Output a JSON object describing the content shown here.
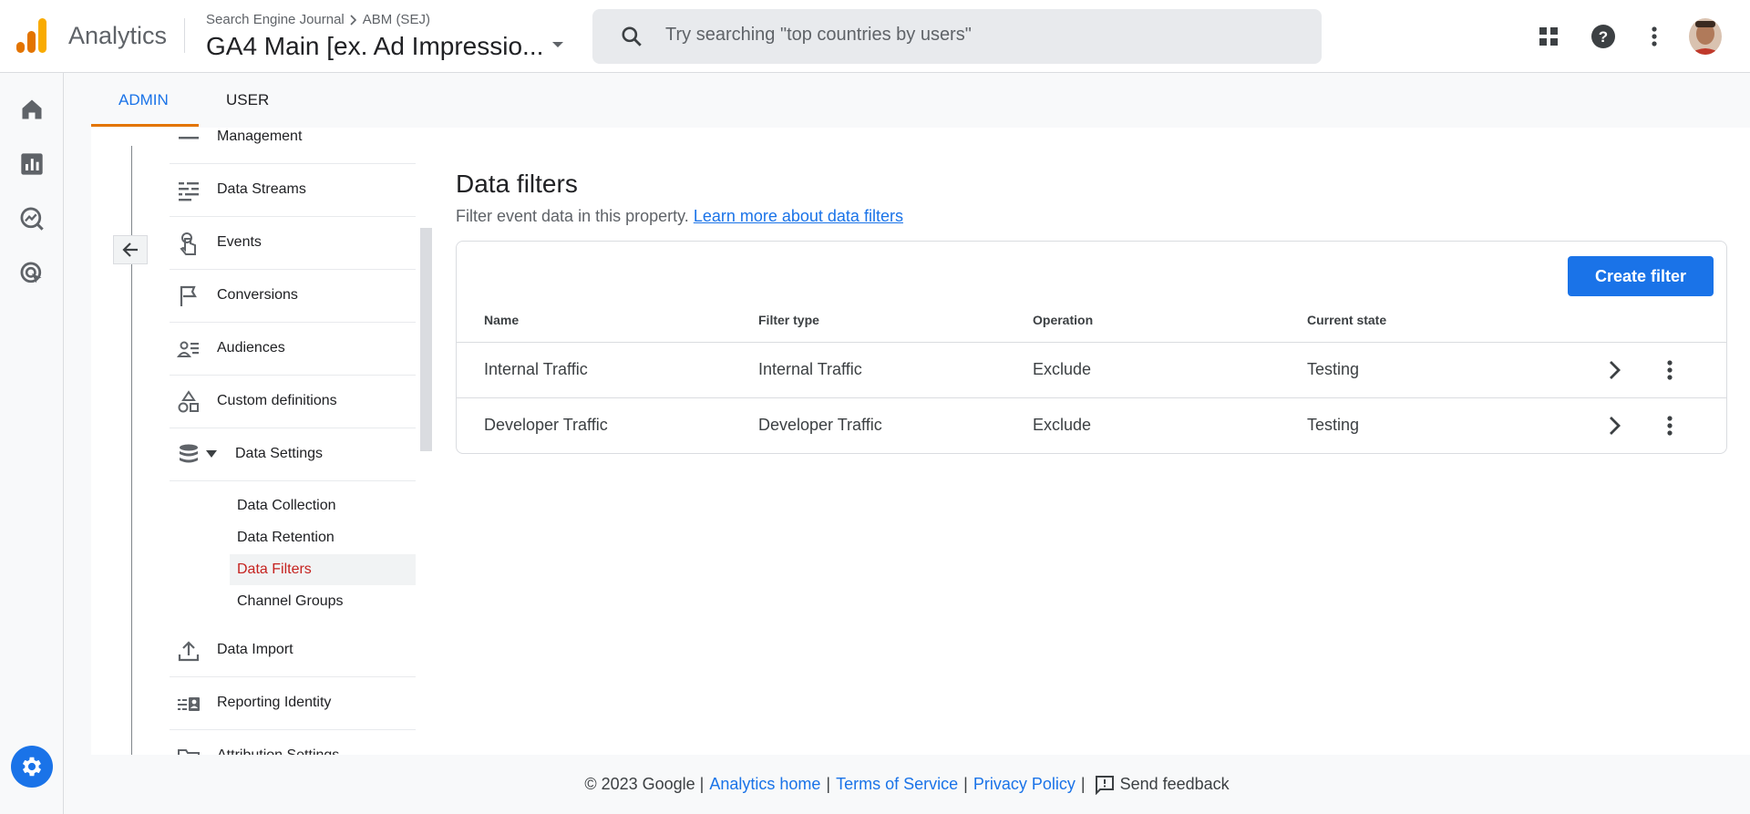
{
  "header": {
    "app_name": "Analytics",
    "breadcrumb_account": "Search Engine Journal",
    "breadcrumb_property": "ABM (SEJ)",
    "property_name": "GA4 Main [ex. Ad Impressio...",
    "search_placeholder": "Try searching \"top countries by users\""
  },
  "tabs": {
    "admin": "ADMIN",
    "user": "USER"
  },
  "nav": {
    "items": [
      {
        "label": "Management"
      },
      {
        "label": "Data Streams"
      },
      {
        "label": "Events"
      },
      {
        "label": "Conversions"
      },
      {
        "label": "Audiences"
      },
      {
        "label": "Custom definitions"
      },
      {
        "label": "Data Settings"
      },
      {
        "label": "Data Import"
      },
      {
        "label": "Reporting Identity"
      },
      {
        "label": "Attribution Settings"
      }
    ],
    "sub_items": [
      {
        "label": "Data Collection"
      },
      {
        "label": "Data Retention"
      },
      {
        "label": "Data Filters"
      },
      {
        "label": "Channel Groups"
      }
    ]
  },
  "main": {
    "title": "Data filters",
    "description": "Filter event data in this property.",
    "learn_more": "Learn more about data filters",
    "create_button": "Create filter",
    "columns": [
      "Name",
      "Filter type",
      "Operation",
      "Current state"
    ],
    "rows": [
      {
        "name": "Internal Traffic",
        "filter_type": "Internal Traffic",
        "operation": "Exclude",
        "state": "Testing"
      },
      {
        "name": "Developer Traffic",
        "filter_type": "Developer Traffic",
        "operation": "Exclude",
        "state": "Testing"
      }
    ]
  },
  "footer": {
    "copyright": "© 2023 Google |",
    "analytics_home": "Analytics home",
    "sep1": "|",
    "terms": "Terms of Service",
    "sep2": "|",
    "privacy": "Privacy Policy",
    "sep3": "|",
    "feedback": "Send feedback"
  },
  "colors": {
    "accent": "#1a73e8",
    "tab_underline": "#e37400",
    "active_nav": "#c5221f"
  }
}
